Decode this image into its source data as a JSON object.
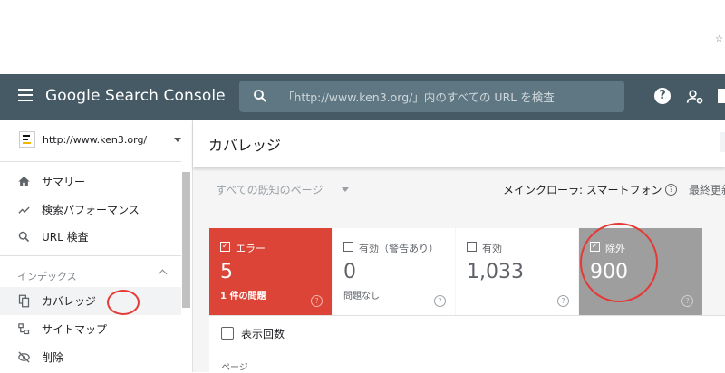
{
  "header": {
    "logo": "Google Search Console",
    "search_placeholder": "「http://www.ken3.org/」内のすべての URL を検査",
    "help_icon": "?"
  },
  "sidebar": {
    "property_url": "http://www.ken3.org/",
    "items": [
      {
        "label": "サマリー",
        "icon": "home-icon"
      },
      {
        "label": "検索パフォーマンス",
        "icon": "trending-up-icon"
      },
      {
        "label": "URL 検査",
        "icon": "search-icon"
      }
    ],
    "section_label": "インデックス",
    "index_items": [
      {
        "label": "カバレッジ",
        "icon": "file-copy-icon",
        "active": true
      },
      {
        "label": "サイトマップ",
        "icon": "sitemap-icon"
      },
      {
        "label": "削除",
        "icon": "visibility-off-icon"
      }
    ]
  },
  "main": {
    "title": "カバレッジ",
    "filter": "すべての既知のページ",
    "crawler": "メインクローラ: スマートフォン",
    "last_updated": "最終更新",
    "cards": [
      {
        "label": "エラー",
        "value": "5",
        "sub": "1 件の問題",
        "checked": true,
        "color": "#db4437"
      },
      {
        "label": "有効（警告あり）",
        "value": "0",
        "sub": "問題なし",
        "checked": false,
        "color": "#ffffff"
      },
      {
        "label": "有効",
        "value": "1,033",
        "sub": "",
        "checked": false,
        "color": "#ffffff"
      },
      {
        "label": "除外",
        "value": "900",
        "sub": "",
        "checked": true,
        "color": "#9e9e9e"
      }
    ],
    "impressions_label": "表示回数",
    "pages_label": "ページ"
  },
  "colors": {
    "header_bg": "#455a64",
    "error": "#db4437",
    "excluded": "#9e9e9e",
    "annotation": "#e53935"
  }
}
